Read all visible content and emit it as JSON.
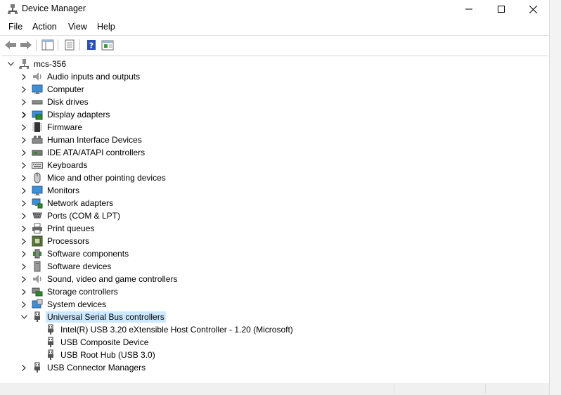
{
  "window": {
    "title": "Device Manager"
  },
  "menubar": {
    "items": [
      "File",
      "Action",
      "View",
      "Help"
    ]
  },
  "toolbar": {
    "buttons": [
      "back-icon",
      "forward-icon",
      "show-hide-tree-icon",
      "properties-icon",
      "help-icon",
      "update-driver-icon"
    ]
  },
  "tree": {
    "root": "mcs-356",
    "categories": [
      "Audio inputs and outputs",
      "Computer",
      "Disk drives",
      "Display adapters",
      "Firmware",
      "Human Interface Devices",
      "IDE ATA/ATAPI controllers",
      "Keyboards",
      "Mice and other pointing devices",
      "Monitors",
      "Network adapters",
      "Ports (COM & LPT)",
      "Print queues",
      "Processors",
      "Software components",
      "Software devices",
      "Sound, video and game controllers",
      "Storage controllers",
      "System devices",
      "Universal Serial Bus controllers"
    ],
    "usb_children": [
      "Intel(R) USB 3.20 eXtensible Host Controller - 1.20 (Microsoft)",
      "USB Composite Device",
      "USB Root Hub (USB 3.0)"
    ],
    "last": "USB Connector Managers"
  },
  "colors": {
    "selection": "#cce8ff",
    "window_bg": "#ffffff"
  }
}
